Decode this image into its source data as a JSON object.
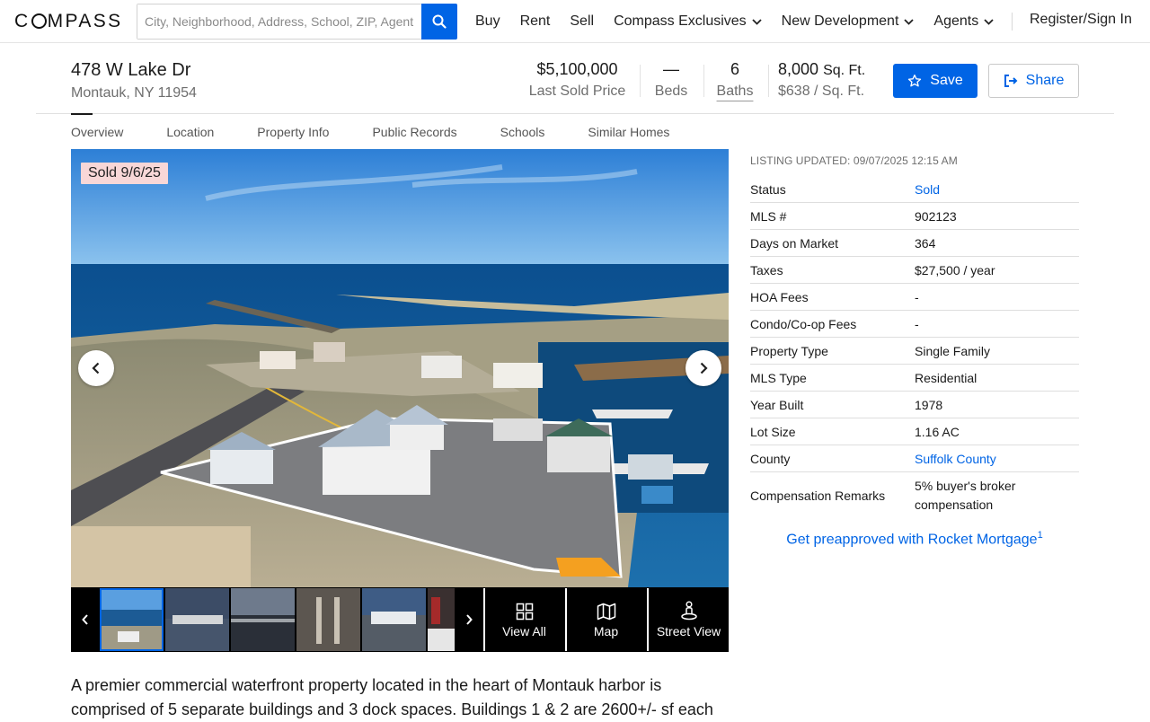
{
  "nav": {
    "logo": "COMPASS",
    "search_placeholder": "City, Neighborhood, Address, School, ZIP, Agent, ID",
    "links": [
      "Buy",
      "Rent",
      "Sell",
      "Compass Exclusives",
      "New Development",
      "Agents"
    ],
    "signin": "Register/Sign In"
  },
  "listing": {
    "address_line1": "478 W Lake Dr",
    "address_line2": "Montauk, NY 11954",
    "price": "$5,100,000",
    "price_label": "Last Sold Price",
    "beds": "—",
    "beds_label": "Beds",
    "baths": "6",
    "baths_label": "Baths",
    "sqft": "8,000",
    "sqft_unit": "Sq. Ft.",
    "price_per_sqft": "$638 / Sq. Ft.",
    "save_label": "Save",
    "share_label": "Share"
  },
  "tabs": [
    "Overview",
    "Location",
    "Property Info",
    "Public Records",
    "Schools",
    "Similar Homes"
  ],
  "gallery": {
    "sold_badge": "Sold 9/6/25",
    "tools": [
      "View All",
      "Map",
      "Street View"
    ]
  },
  "facts": {
    "updated": "LISTING UPDATED: 09/07/2025 12:15 AM",
    "rows": [
      {
        "k": "Status",
        "v": "Sold"
      },
      {
        "k": "MLS #",
        "v": "902123"
      },
      {
        "k": "Days on Market",
        "v": "364"
      },
      {
        "k": "Taxes",
        "v": "$27,500 / year"
      },
      {
        "k": "HOA Fees",
        "v": "-"
      },
      {
        "k": "Condo/Co-op Fees",
        "v": "-"
      },
      {
        "k": "Property Type",
        "v": "Single Family"
      },
      {
        "k": "MLS Type",
        "v": "Residential"
      },
      {
        "k": "Year Built",
        "v": "1978"
      },
      {
        "k": "Lot Size",
        "v": "1.16 AC"
      },
      {
        "k": "County",
        "v": "Suffolk County"
      },
      {
        "k": "Compensation Remarks",
        "v": "5% buyer's broker compensation"
      }
    ],
    "mortgage_link": "Get preapproved with Rocket Mortgage",
    "mortgage_sup": "1"
  },
  "description": "A premier commercial waterfront property located in the heart of Montauk harbor is comprised of 5 separate buildings and 3 dock spaces. Buildings 1 & 2 are 2600+/- sf each",
  "colors": {
    "accent": "#0064e5",
    "sold_badge_bg": "#f8d7d7"
  }
}
